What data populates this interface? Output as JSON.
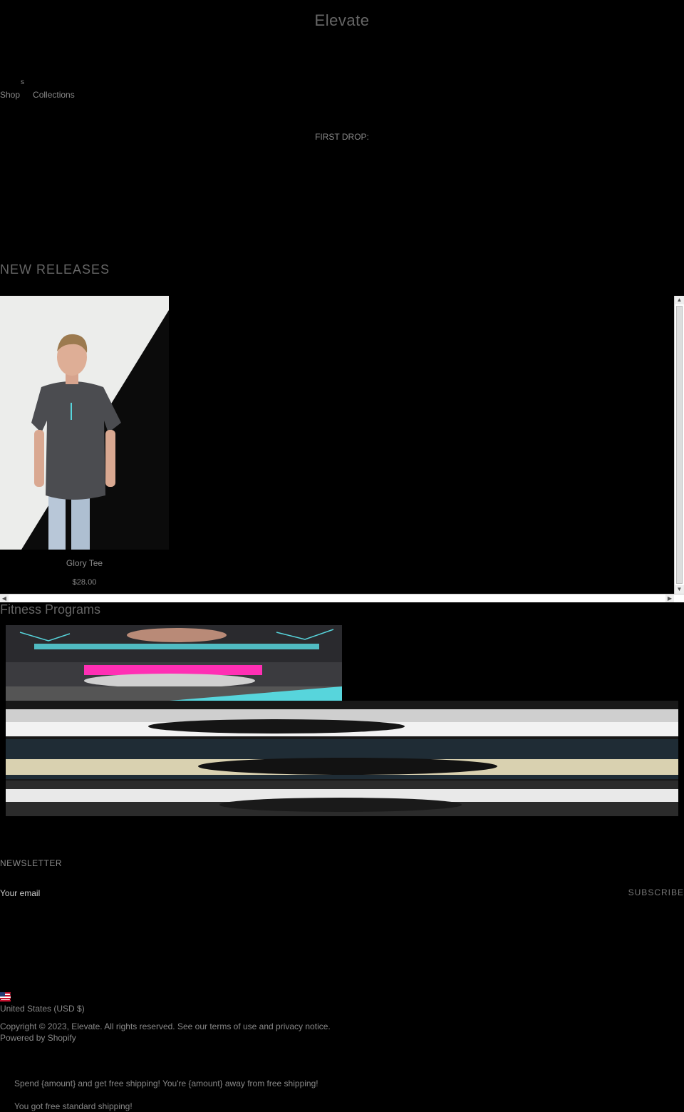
{
  "header": {
    "brand": "Elevate",
    "menu_icon": "s",
    "nav": [
      "Shop",
      "Collections"
    ]
  },
  "hero": {
    "text": "FIRST DROP:"
  },
  "new_releases": {
    "title": "NEW RELEASES",
    "products": [
      {
        "name": "Glory Tee",
        "price": "$28.00"
      }
    ]
  },
  "fitness": {
    "title": "Fitness Programs"
  },
  "newsletter": {
    "title": "NEWSLETTER",
    "email_placeholder": "Your email",
    "subscribe_label": "SUBSCRIBE"
  },
  "footer": {
    "country": "United States (USD $)",
    "copyright": "Copyright © 2023, Elevate. All rights reserved. See our terms of use and privacy notice.",
    "powered_by": "Powered by Shopify"
  },
  "shipping": {
    "message": "Spend {amount} and get free shipping! You're {amount} away from free shipping!",
    "free_message": "You got free standard shipping!"
  },
  "colors": {
    "background": "#000000",
    "text_muted": "#888888",
    "accent_cyan": "#57d5dc",
    "accent_pink": "#ff2fb4"
  }
}
